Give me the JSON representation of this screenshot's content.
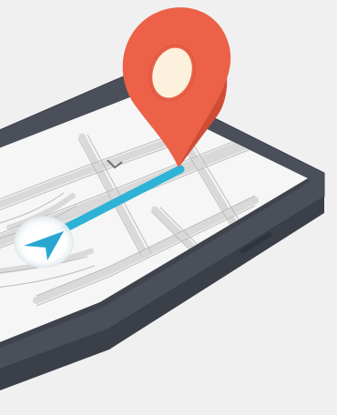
{
  "illustration": {
    "subject": "navigation-app-on-smartphone",
    "icons": {
      "phone": "smartphone-icon",
      "pin": "map-pin-icon",
      "arrow": "navigation-arrow-icon",
      "route": "route-line-icon"
    },
    "colors": {
      "background": "#f0f0f0",
      "phone_body": "#4a4f5a",
      "phone_side": "#3b3f48",
      "screen": "#f6f6f6",
      "road": "#d9d9d9",
      "route": "#2db3d6",
      "pin": "#ec6148",
      "pin_dark": "#cf4c35",
      "pin_center": "#fbf1dc",
      "arrow": "#2aa7d0"
    }
  }
}
